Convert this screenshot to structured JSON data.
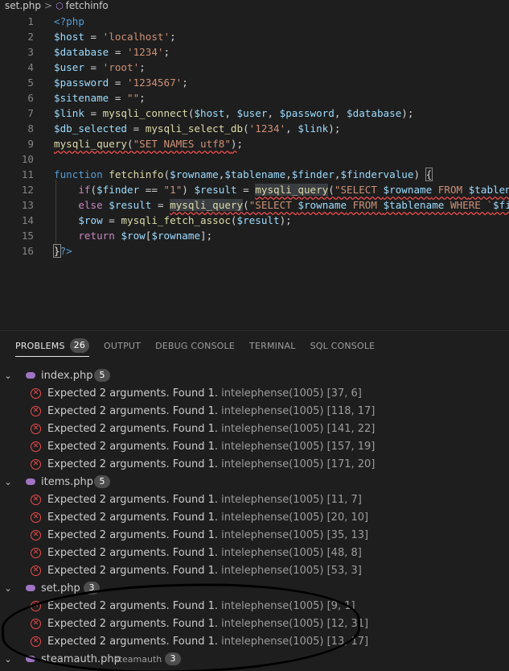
{
  "breadcrumb": {
    "file": "set.php",
    "separator": ">",
    "symbol": "fetchinfo"
  },
  "editor": {
    "line_numbers": [
      "1",
      "2",
      "3",
      "4",
      "5",
      "6",
      "7",
      "8",
      "9",
      "10",
      "11",
      "12",
      "13",
      "14",
      "15",
      "16"
    ]
  },
  "panel": {
    "tabs": [
      {
        "label": "PROBLEMS",
        "count": "26"
      },
      {
        "label": "OUTPUT"
      },
      {
        "label": "DEBUG CONSOLE"
      },
      {
        "label": "TERMINAL"
      },
      {
        "label": "SQL CONSOLE"
      }
    ],
    "groups": [
      {
        "file": "index.php",
        "count": "5",
        "items": [
          {
            "message": "Expected 2 arguments. Found 1.",
            "source": "intelephense(1005)",
            "position": "[37, 6]"
          },
          {
            "message": "Expected 2 arguments. Found 1.",
            "source": "intelephense(1005)",
            "position": "[118, 17]"
          },
          {
            "message": "Expected 2 arguments. Found 1.",
            "source": "intelephense(1005)",
            "position": "[141, 22]"
          },
          {
            "message": "Expected 2 arguments. Found 1.",
            "source": "intelephense(1005)",
            "position": "[157, 19]"
          },
          {
            "message": "Expected 2 arguments. Found 1.",
            "source": "intelephense(1005)",
            "position": "[171, 20]"
          }
        ]
      },
      {
        "file": "items.php",
        "count": "5",
        "items": [
          {
            "message": "Expected 2 arguments. Found 1.",
            "source": "intelephense(1005)",
            "position": "[11, 7]"
          },
          {
            "message": "Expected 2 arguments. Found 1.",
            "source": "intelephense(1005)",
            "position": "[20, 10]"
          },
          {
            "message": "Expected 2 arguments. Found 1.",
            "source": "intelephense(1005)",
            "position": "[35, 13]"
          },
          {
            "message": "Expected 2 arguments. Found 1.",
            "source": "intelephense(1005)",
            "position": "[48, 8]"
          },
          {
            "message": "Expected 2 arguments. Found 1.",
            "source": "intelephense(1005)",
            "position": "[53, 3]"
          }
        ]
      },
      {
        "file": "set.php",
        "count": "3",
        "items": [
          {
            "message": "Expected 2 arguments. Found 1.",
            "source": "intelephense(1005)",
            "position": "[9, 1]"
          },
          {
            "message": "Expected 2 arguments. Found 1.",
            "source": "intelephense(1005)",
            "position": "[12, 31]"
          },
          {
            "message": "Expected 2 arguments. Found 1.",
            "source": "intelephense(1005)",
            "position": "[13, 17]"
          }
        ]
      },
      {
        "file": "steamauth.php",
        "subtitle": "steamauth",
        "count": "3",
        "items": []
      }
    ]
  },
  "colors": {
    "background": "#1e1e1e",
    "error": "#f14c4c",
    "php_icon": "#a074c4",
    "annotation": "#000000"
  }
}
